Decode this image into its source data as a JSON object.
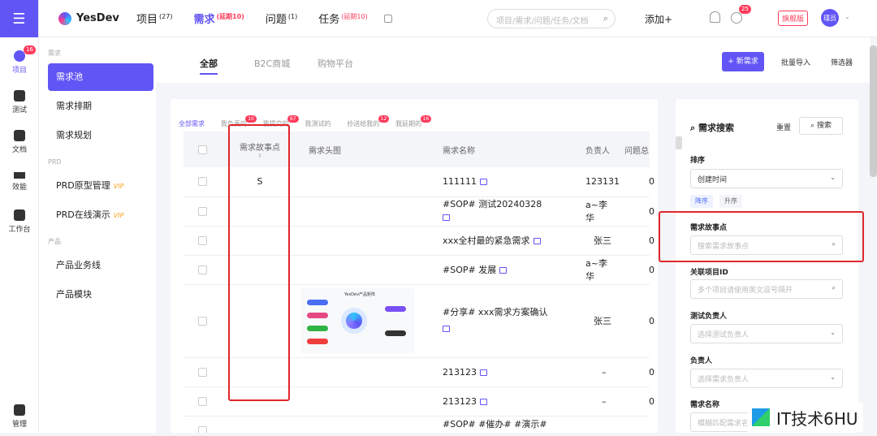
{
  "rail": {
    "items": [
      {
        "label": "项目",
        "badge": "16"
      },
      {
        "label": "测试"
      },
      {
        "label": "文档"
      },
      {
        "label": "效能"
      },
      {
        "label": "工作台"
      },
      {
        "label": "管理"
      }
    ]
  },
  "topbar": {
    "brand": "YesDev",
    "nav": [
      {
        "label": "项目",
        "sup": "(27)"
      },
      {
        "label": "需求",
        "sup": "(延期10)"
      },
      {
        "label": "问题",
        "sup": "(1)"
      },
      {
        "label": "任务",
        "sup": "(延期10)"
      }
    ],
    "search_placeholder": "项目/需求/问题/任务/文档",
    "add_label": "添加+",
    "clock_badge": "25",
    "edition": "旗舰版",
    "avatar": "瑾员"
  },
  "sidebar": {
    "groups": [
      {
        "title": "需求",
        "items": [
          {
            "label": "需求池"
          },
          {
            "label": "需求排期"
          },
          {
            "label": "需求规划"
          }
        ]
      },
      {
        "title": "PRD",
        "items": [
          {
            "label": "PRD原型管理",
            "vip": "VIP"
          },
          {
            "label": "PRD在线演示",
            "vip": "VIP"
          }
        ]
      },
      {
        "title": "产品",
        "items": [
          {
            "label": "产品业务线"
          },
          {
            "label": "产品模块"
          }
        ]
      }
    ]
  },
  "main": {
    "tabs": [
      "全部",
      "B2C商城",
      "购物平台"
    ],
    "new_button": "+ 新需求",
    "bulk_import": "批量导入",
    "filter": "筛选器",
    "subtabs": [
      {
        "label": "全部需求"
      },
      {
        "label": "我负责的",
        "badge": "10"
      },
      {
        "label": "我提交的",
        "badge": "67"
      },
      {
        "label": "我测试的"
      },
      {
        "label": "抄送给我的",
        "badge": "12"
      },
      {
        "label": "我延期的",
        "badge": "16"
      }
    ],
    "table": {
      "headers": [
        "需求故事点",
        "需求头图",
        "需求名称",
        "负责人",
        "问题总"
      ],
      "rows": [
        {
          "points": "S",
          "name": "111111",
          "owner": "123131",
          "issues": "0"
        },
        {
          "points": "",
          "name": "#SOP# 测试20240328",
          "owner": "a~李华",
          "issues": "0"
        },
        {
          "points": "",
          "name": "xxx全村最的紧急需求",
          "owner": "张三",
          "issues": "0"
        },
        {
          "points": "",
          "name": "#SOP# 发展",
          "owner": "a~李华",
          "issues": "0"
        },
        {
          "points": "",
          "name": "#分享# xxx需求方案确认",
          "owner": "张三",
          "issues": "0",
          "image_title": "YesDev产品矩阵"
        },
        {
          "points": "",
          "name": "213123",
          "owner": "–",
          "issues": "0"
        },
        {
          "points": "",
          "name": "213123",
          "owner": "–",
          "issues": "0"
        },
        {
          "points": "",
          "name": "#SOP# #催办# #演示# 开",
          "owner": "",
          "issues": ""
        }
      ]
    }
  },
  "panel": {
    "title": "需求搜索",
    "reset": "重置",
    "search_button": "搜索",
    "sort_label": "排序",
    "sort_value": "创建时间",
    "order_desc": "降序",
    "order_asc": "升序",
    "points_label": "需求故事点",
    "points_placeholder": "搜索需求故事点",
    "project_label": "关联项目ID",
    "project_placeholder": "多个项目请使用英文逗号隔开",
    "tester_label": "测试负责人",
    "tester_placeholder": "选择测试负责人",
    "owner_label": "负责人",
    "owner_placeholder": "选择需求负责人",
    "name_label": "需求名称",
    "name_placeholder": "模糊匹配需求名称"
  },
  "watermark": "IT技术6HU",
  "colors": {
    "accent": "#6155f5",
    "badge": "#ff3b5c",
    "highlight": "#e0262b"
  }
}
